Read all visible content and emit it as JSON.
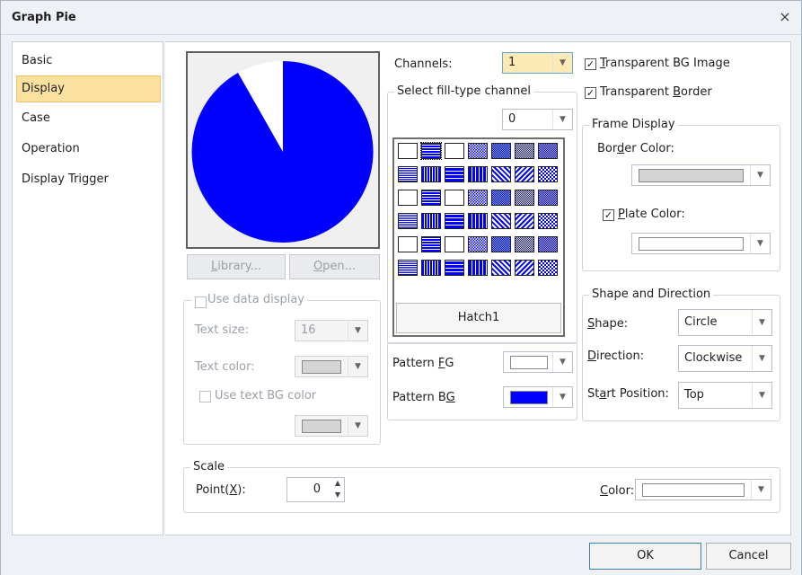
{
  "window": {
    "title": "Graph Pie",
    "close_icon": "×"
  },
  "nav": {
    "items": [
      "Basic",
      "Display",
      "Case",
      "Operation",
      "Display Trigger"
    ],
    "selected": "Display"
  },
  "preview": {
    "fill_color": "#0000ff",
    "background_color": "#ffffff",
    "library_label": "Library...",
    "open_label": "Open..."
  },
  "data_display": {
    "use_data_display_label": "Use data display",
    "use_data_display_checked": false,
    "text_size_label": "Text size:",
    "text_size_value": "16",
    "text_color_label": "Text color:",
    "text_color_value": "#d4d4d4",
    "use_text_bg_label": "Use text BG color",
    "use_text_bg_checked": false,
    "text_bg_value": "#d4d4d4"
  },
  "channels": {
    "label": "Channels:",
    "value": "1"
  },
  "fill_channel": {
    "group_label": "Select fill-type channel",
    "value": "0"
  },
  "hatch": {
    "selected_name": "Hatch1",
    "selected_index": 1,
    "pattern_count": 42
  },
  "pattern": {
    "fg_label": "Pattern FG",
    "fg_color": "#ffffff",
    "bg_label": "Pattern BG",
    "bg_color": "#0000ff"
  },
  "transparency": {
    "bg_image_label": "Transparent BG Image",
    "bg_image_checked": true,
    "border_label": "Transparent Border",
    "border_checked": true
  },
  "frame_display": {
    "group_label": "Frame Display",
    "border_color_label": "Border Color:",
    "border_color_value": "#d4d4d4",
    "plate_color_label": "Plate Color:",
    "plate_color_checked": true,
    "plate_color_value": "#ffffff"
  },
  "shape_direction": {
    "group_label": "Shape and Direction",
    "shape_label": "Shape:",
    "shape_value": "Circle",
    "direction_label": "Direction:",
    "direction_value": "Clockwise",
    "start_label": "Start Position:",
    "start_value": "Top"
  },
  "scale": {
    "group_label": "Scale",
    "point_label": "Point(X):",
    "point_value": "0",
    "color_label": "Color:",
    "color_value": "#ffffff"
  },
  "footer": {
    "ok_label": "OK",
    "cancel_label": "Cancel"
  }
}
